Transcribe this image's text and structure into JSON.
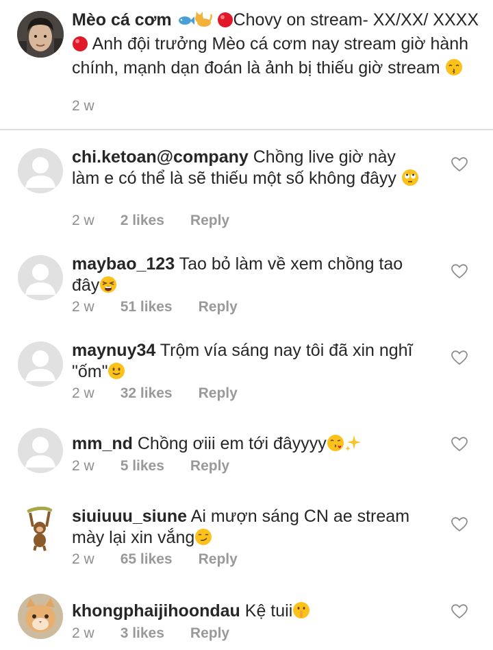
{
  "post": {
    "username": "Mèo cá cơm",
    "caption_parts": {
      "a": "Chovy on stream- XX/XX/",
      "b": "XXXX",
      "c": " Anh đội trưởng Mèo cá cơm nay stream giờ hành chính, mạnh dạn đoán là ảnh bị thiếu giờ stream"
    },
    "time": "2 w"
  },
  "comments": [
    {
      "username": "chi.ketoan@company",
      "text": "Chồng live giờ này làm e có thể là sẽ thiếu một số không đâyy",
      "time": "2 w",
      "likes": "2 likes",
      "reply": "Reply",
      "avatar": "placeholder"
    },
    {
      "username": "maybao_123",
      "text": "Tao bỏ làm về xem chồng tao đây",
      "time": "2 w",
      "likes": "51 likes",
      "reply": "Reply",
      "avatar": "placeholder"
    },
    {
      "username": "maynuy34",
      "text": "Trộm vía sáng nay tôi đã xin nghĩ \"ốm\"",
      "time": "2 w",
      "likes": "32 likes",
      "reply": "Reply",
      "avatar": "placeholder"
    },
    {
      "username": "mm_nd",
      "text": "Chồng ơiii em tới đâyyyy",
      "time": "2 w",
      "likes": "5 likes",
      "reply": "Reply",
      "avatar": "placeholder"
    },
    {
      "username": "siuiuuu_siune",
      "text": "Ai mượn sáng CN ae stream mày lại xin vắng",
      "time": "2 w",
      "likes": "65 likes",
      "reply": "Reply",
      "avatar": "monkey"
    },
    {
      "username": "khongphaijihoondau",
      "text": "Kệ tuii",
      "time": "2 w",
      "likes": "3 likes",
      "reply": "Reply",
      "avatar": "cat"
    }
  ],
  "icons": {
    "like": "heart-outline-icon",
    "placeholder_avatar": "default-user-icon"
  },
  "colors": {
    "text": "#262626",
    "meta": "#8e8e8e",
    "divider": "#dbdbdb",
    "placeholder_bg": "#e1e1e1"
  }
}
